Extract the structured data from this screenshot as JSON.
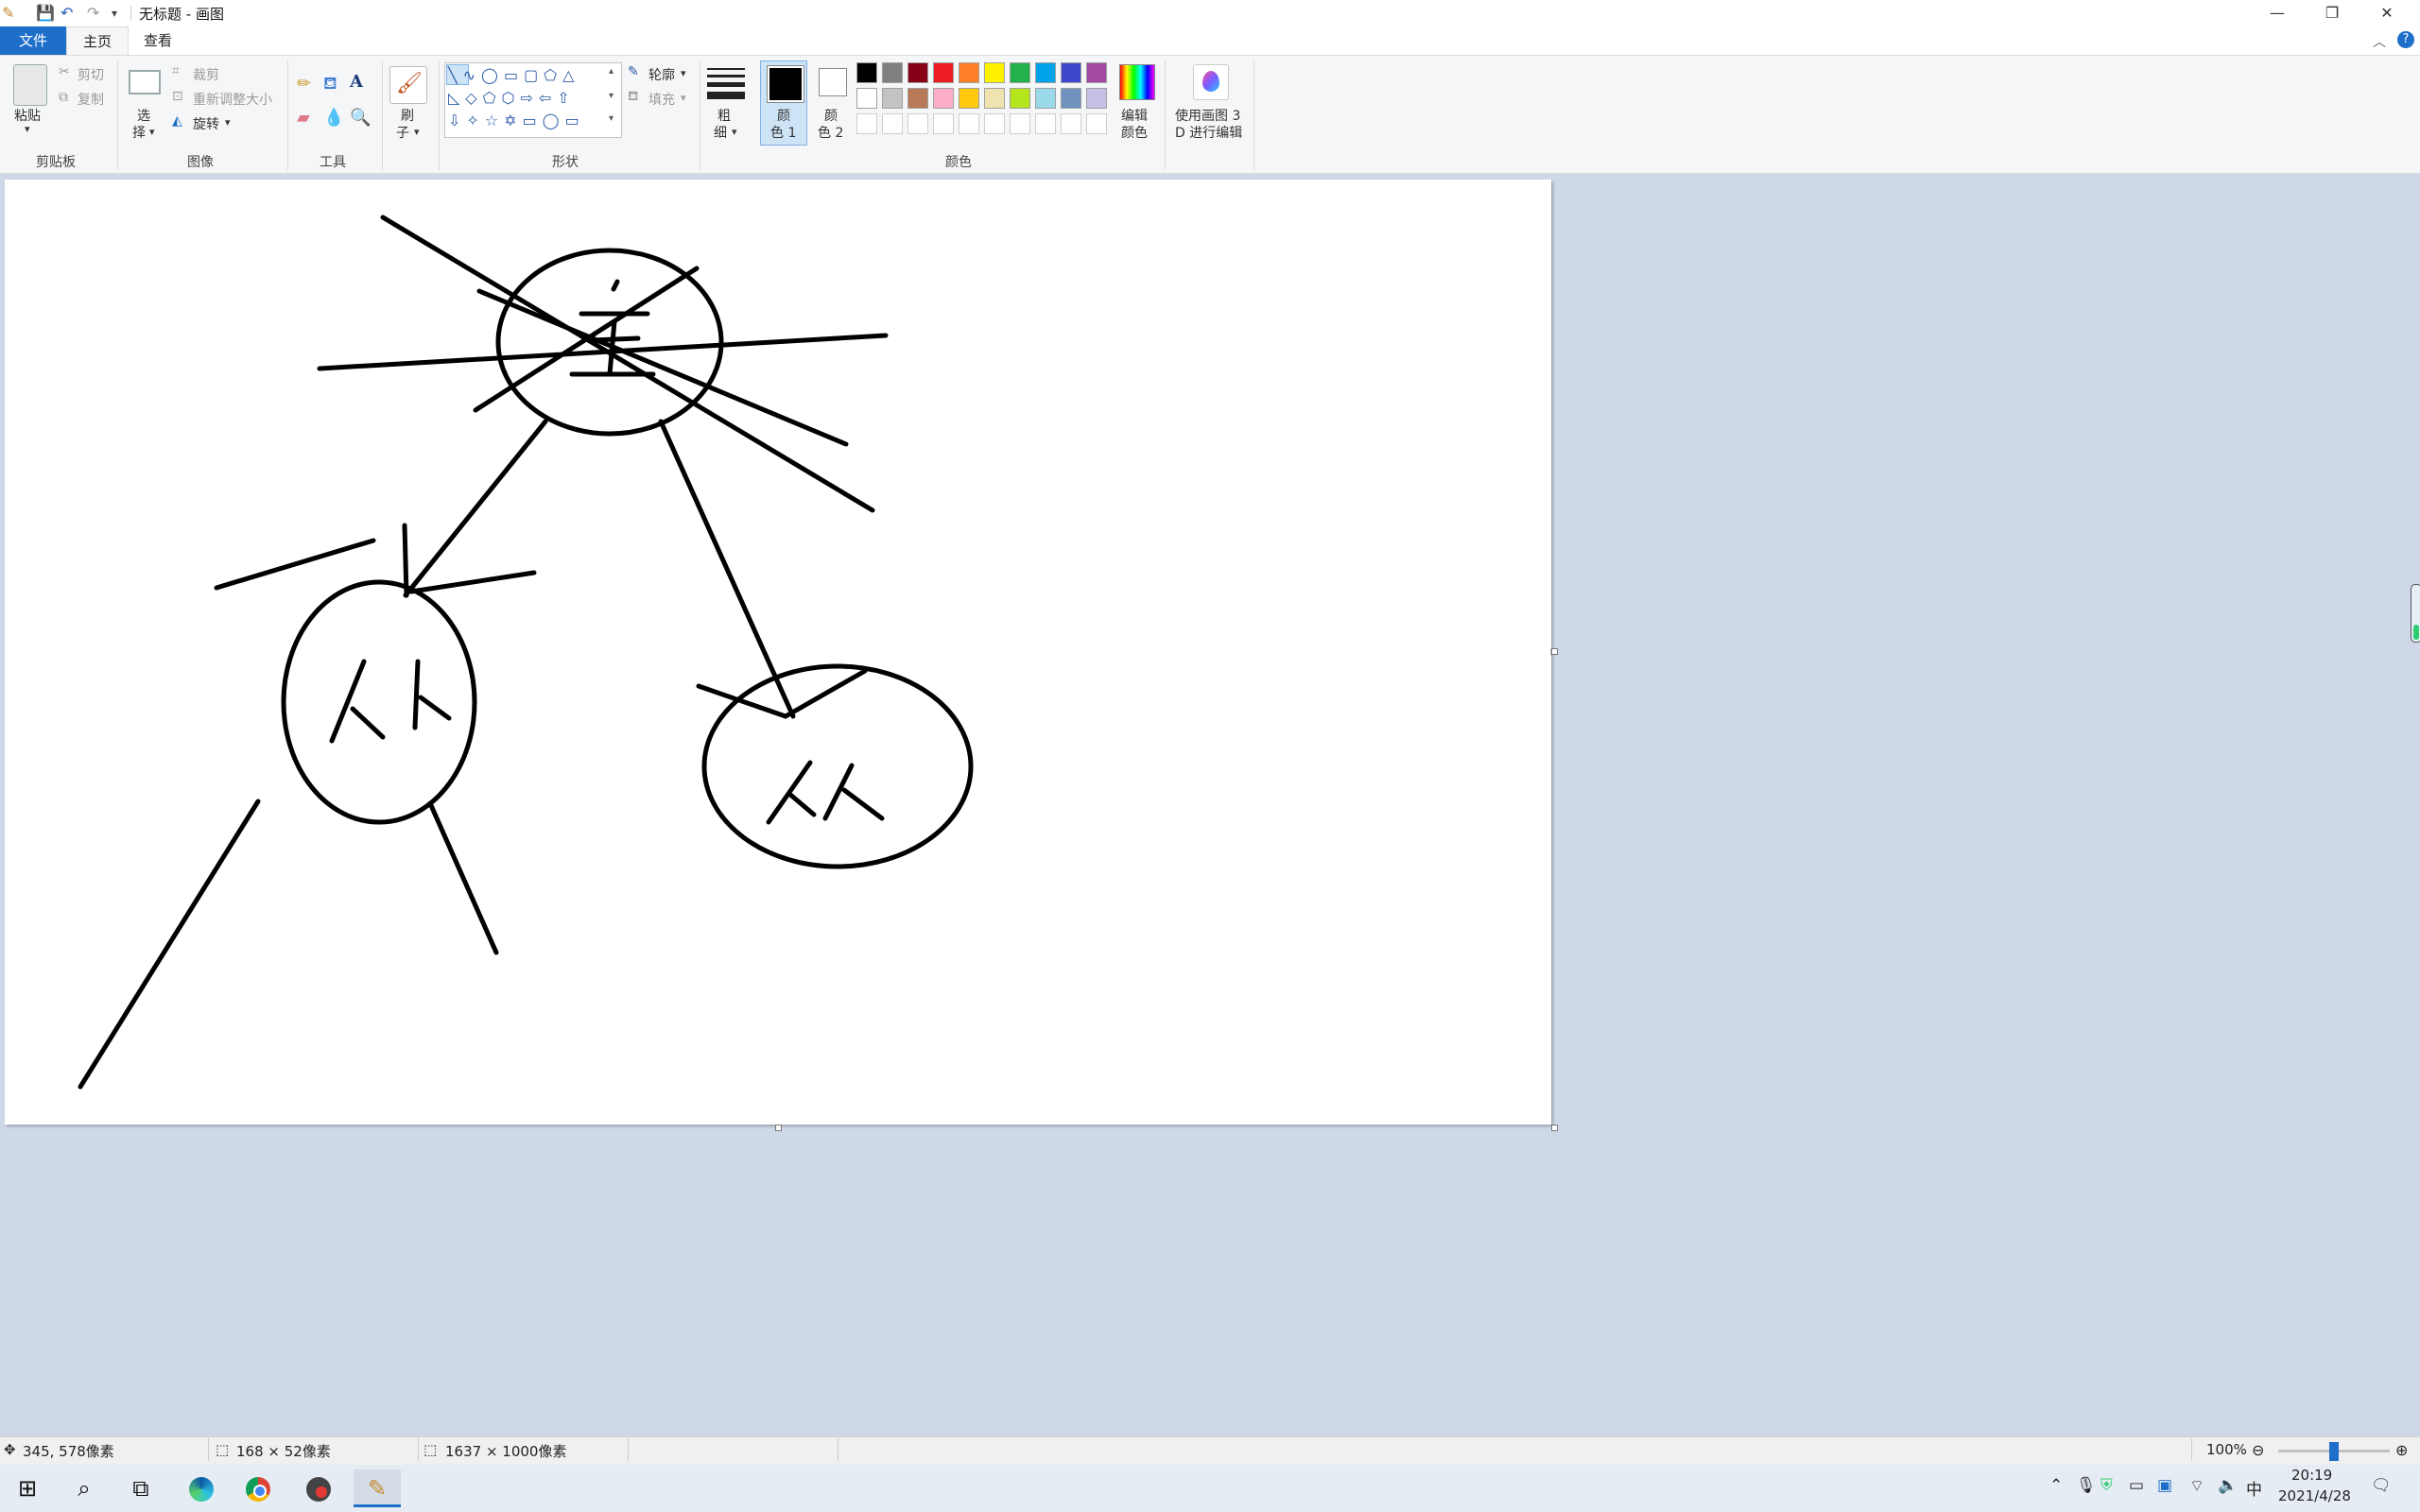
{
  "window": {
    "title": "无标题 - 画图",
    "minimize_icon": "minimize-icon",
    "restore_icon": "restore-icon",
    "close_icon": "close-icon"
  },
  "tabs": {
    "file": "文件",
    "home": "主页",
    "view": "查看"
  },
  "ribbon": {
    "clipboard": {
      "label": "剪贴板",
      "paste": "粘贴",
      "cut": "剪切",
      "copy": "复制"
    },
    "image": {
      "label": "图像",
      "select_top": "选",
      "select_bottom": "择",
      "crop": "裁剪",
      "resize": "重新调整大小",
      "rotate": "旋转"
    },
    "tools": {
      "label": "工具"
    },
    "brush": {
      "top": "刷",
      "bottom": "子"
    },
    "shapes": {
      "label": "形状",
      "outline": "轮廓",
      "fill": "填充"
    },
    "size": {
      "top": "粗",
      "bottom": "细"
    },
    "color1": {
      "top": "颜",
      "bottom": "色 1"
    },
    "color2": {
      "top": "颜",
      "bottom": "色 2"
    },
    "colors": {
      "label": "颜色",
      "edit_top": "编辑",
      "edit_bottom": "颜色",
      "palette_row1": [
        "#000000",
        "#7f7f7f",
        "#880015",
        "#ed1c24",
        "#ff7f27",
        "#fff200",
        "#22b14c",
        "#00a2e8",
        "#3f48cc",
        "#a349a4"
      ],
      "palette_row2": [
        "#ffffff",
        "#c3c3c3",
        "#b97a57",
        "#ffaec9",
        "#ffc90e",
        "#efe4b0",
        "#b5e61d",
        "#99d9ea",
        "#7092be",
        "#c8bfe7"
      ],
      "palette_row3": [
        "#ffffff",
        "#ffffff",
        "#ffffff",
        "#ffffff",
        "#ffffff",
        "#ffffff",
        "#ffffff",
        "#ffffff",
        "#ffffff",
        "#ffffff"
      ]
    },
    "paint3d": {
      "line1": "使用画图 3",
      "line2": "D 进行编辑"
    }
  },
  "status": {
    "cursor_pos": "345, 578像素",
    "selection_size": "168 × 52像素",
    "image_size": "1637 × 1000像素",
    "zoom": "100%",
    "zoom_level": 0.5
  },
  "taskbar": {
    "time": "20:19",
    "date": "2021/4/28",
    "ime": "中"
  }
}
